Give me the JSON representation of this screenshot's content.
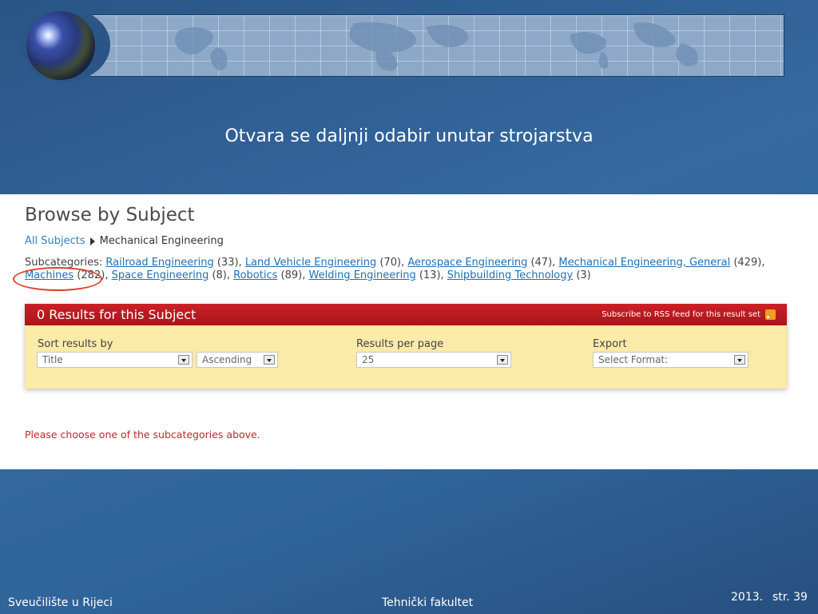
{
  "slide": {
    "title": "Otvara se daljnji odabir unutar strojarstva"
  },
  "page": {
    "heading": "Browse by Subject",
    "breadcrumb": {
      "root": "All Subjects",
      "current": "Mechanical Engineering"
    },
    "subcategories_label": "Subcategories:",
    "subcategories": [
      {
        "name": "Railroad Engineering",
        "count": "(33)"
      },
      {
        "name": "Land Vehicle Engineering",
        "count": "(70)"
      },
      {
        "name": "Aerospace Engineering",
        "count": "(47)"
      },
      {
        "name": "Mechanical Engineering, General",
        "count": "(429)"
      },
      {
        "name": "Machines",
        "count": "(282)"
      },
      {
        "name": "Space Engineering",
        "count": "(8)"
      },
      {
        "name": "Robotics",
        "count": "(89)"
      },
      {
        "name": "Welding Engineering",
        "count": "(13)"
      },
      {
        "name": "Shipbuilding Technology",
        "count": "(3)"
      }
    ],
    "results": {
      "count_text": "0 Results for this Subject",
      "rss_text": "Subscribe to RSS feed for this result set",
      "sort_label": "Sort results by",
      "sort_field": "Title",
      "sort_order": "Ascending",
      "per_page_label": "Results per page",
      "per_page": "25",
      "export_label": "Export",
      "export_format": "Select Format:"
    },
    "notice": "Please choose one of the subcategories above."
  },
  "footer": {
    "left": "Sveučilište u Rijeci",
    "center": "Tehnički fakultet",
    "year": "2013.",
    "page": "str. 39"
  },
  "colors": {
    "accent_red": "#cc2026",
    "link_blue": "#1f6fb5",
    "results_bg": "#fbeaa8",
    "highlight_circle": "#d9442c"
  }
}
